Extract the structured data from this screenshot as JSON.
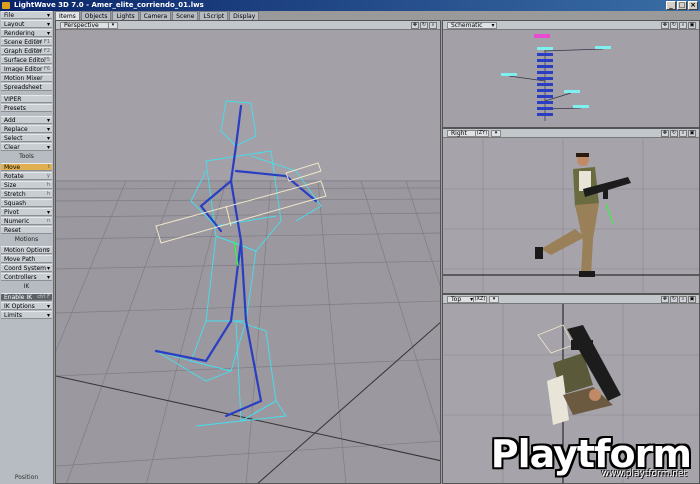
{
  "app": {
    "title": "LightWave 3D 7.0 - Amer_elite_corriendo_01.lws",
    "win_buttons": [
      "_",
      "□",
      "×"
    ]
  },
  "tabs": [
    "Items",
    "Objects",
    "Lights",
    "Camera",
    "Scene",
    "LScript",
    "Display"
  ],
  "active_tab": "Items",
  "sidebar": {
    "file": "File",
    "layout": "Layout",
    "rendering": "Rendering",
    "scene_editor": "Scene Editor",
    "scene_editor_key": "Ctrl F1",
    "graph_editor": "Graph Editor",
    "graph_editor_key": "Ctrl F2",
    "surface_editor": "Surface Editor",
    "surface_editor_key": "F5",
    "image_editor": "Image Editor",
    "image_editor_key": "F6",
    "motion_mixer": "Motion Mixer",
    "spreadsheet": "Spreadsheet",
    "viper": "VIPER",
    "presets": "Presets",
    "add": "Add",
    "replace": "Replace",
    "select": "Select",
    "clear": "Clear",
    "tools_header": "Tools",
    "move": "Move",
    "move_key": "t",
    "rotate": "Rotate",
    "rotate_key": "y",
    "size": "Size",
    "size_key": "h",
    "stretch": "Stretch",
    "stretch_key": "h",
    "squash": "Squash",
    "pivot": "Pivot",
    "numeric": "Numeric",
    "numeric_key": "n",
    "reset": "Reset",
    "motions_header": "Motions",
    "motion_options": "Motion Options",
    "motion_options_key": "m",
    "move_path": "Move Path",
    "coord_system": "Coord System",
    "controllers": "Controllers",
    "ik_header": "IK",
    "enable_ik": "Enable IK",
    "enable_ik_key": "ctrl F",
    "ik_options": "IK Options",
    "limits": "Limits",
    "bottom_label": "Position"
  },
  "viewports": {
    "main": "Perspective",
    "schematic": "Schematic",
    "right": "Right",
    "right_axis": "(ZY)",
    "top": "Top",
    "top_axis": "(XZ)"
  },
  "viewport_icons": [
    "move-view-icon",
    "rotate-view-icon",
    "zoom-view-icon",
    "maximize-view-icon"
  ],
  "watermark": {
    "brand": "Playtform",
    "url": "www.playtform.net"
  }
}
